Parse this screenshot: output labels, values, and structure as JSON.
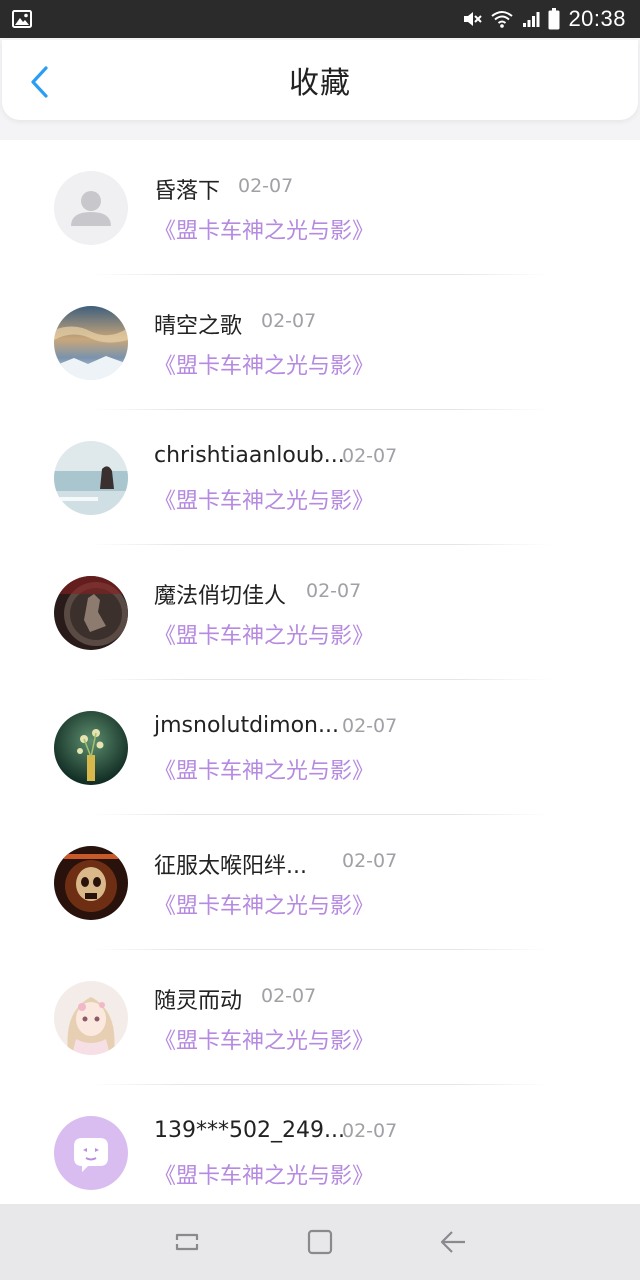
{
  "status_bar": {
    "time": "20:38",
    "icons": [
      "image-icon",
      "mute-icon",
      "wifi-icon",
      "signal-icon",
      "battery-icon"
    ]
  },
  "header": {
    "title": "收藏",
    "back_icon": "chevron-left-icon"
  },
  "colors": {
    "accent": "#2a9df4",
    "link": "#b58ae0",
    "date": "#a0a0a6",
    "name": "#222222"
  },
  "favorites": [
    {
      "name": "昏落下",
      "date": "02-07",
      "title": "《盟卡车神之光与影》",
      "avatar": "default-user-avatar"
    },
    {
      "name": "晴空之歌",
      "date": "02-07",
      "title": "《盟卡车神之光与影》",
      "avatar": "sky-photo-avatar"
    },
    {
      "name": "chrishtiaanloub...",
      "date": "02-07",
      "title": "《盟卡车神之光与影》",
      "avatar": "beach-photo-avatar"
    },
    {
      "name": "魔法俏切佳人",
      "date": "02-07",
      "title": "《盟卡车神之光与影》",
      "avatar": "coin-photo-avatar"
    },
    {
      "name": "jmsnolutdimon...",
      "date": "02-07",
      "title": "《盟卡车神之光与影》",
      "avatar": "flower-photo-avatar"
    },
    {
      "name": "征服太喉阳绊...",
      "date": "02-07",
      "title": "《盟卡车神之光与影》",
      "avatar": "skull-photo-avatar"
    },
    {
      "name": "随灵而动",
      "date": "02-07",
      "title": "《盟卡车神之光与影》",
      "avatar": "anime-girl-avatar"
    },
    {
      "name": "139***502_249...",
      "date": "02-07",
      "title": "《盟卡车神之光与影》",
      "avatar": "chat-bubble-avatar"
    }
  ],
  "nav_bar": {
    "icons": [
      "recents-icon",
      "home-icon",
      "back-icon"
    ]
  }
}
